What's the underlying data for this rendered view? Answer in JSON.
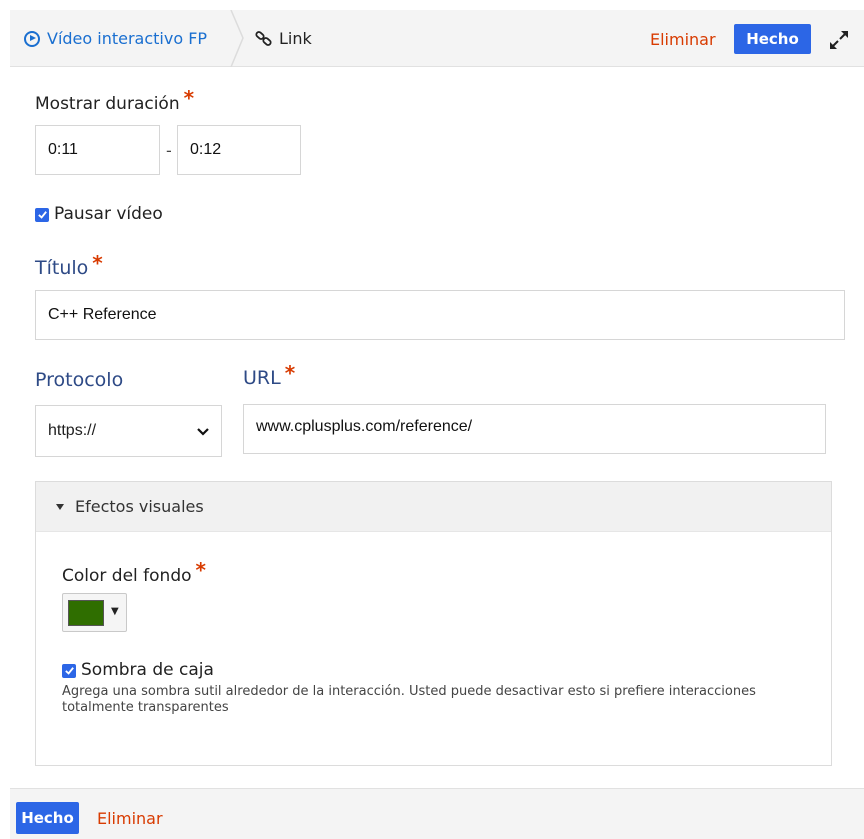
{
  "header": {
    "breadcrumb_parent": "Vídeo interactivo FP",
    "breadcrumb_current": "Link",
    "delete_label": "Eliminar",
    "done_label": "Hecho",
    "play_icon": "play-circle-icon",
    "link_icon": "link-icon",
    "fullscreen_icon": "expand-icon"
  },
  "form": {
    "duration": {
      "label": "Mostrar duración",
      "required_mark": "*",
      "start": "0:11",
      "separator": "-",
      "end": "0:12"
    },
    "pause_video": {
      "label": "Pausar vídeo",
      "checked": true
    },
    "title": {
      "label": "Título",
      "required_mark": "*",
      "value": "C++ Reference"
    },
    "protocol": {
      "label": "Protocolo",
      "value": "https://"
    },
    "url": {
      "label": "URL",
      "required_mark": "*",
      "value": "www.cplusplus.com/reference/"
    }
  },
  "visual_effects": {
    "header_label": "Efectos visuales",
    "expanded": true,
    "background_color": {
      "label": "Color del fondo",
      "required_mark": "*",
      "value": "#2f6e00"
    },
    "box_shadow": {
      "label": "Sombra de caja",
      "checked": true,
      "description": "Agrega una sombra sutil alrededor de la interacción. Usted puede desactivar esto si prefiere interacciones totalmente transparentes"
    }
  },
  "footer": {
    "done_label": "Hecho",
    "delete_label": "Eliminar"
  },
  "colors": {
    "accent": "#2c66e6",
    "danger": "#d83b01",
    "heading_blue": "#2e4a86"
  }
}
